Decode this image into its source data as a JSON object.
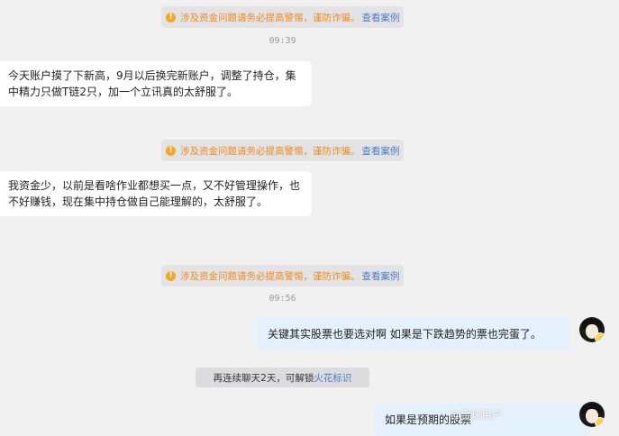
{
  "notices": [
    {
      "text": "涉及资金问题请务必提高警惕，谨防诈骗。",
      "link": "查看案例"
    },
    {
      "text": "涉及资金问题请务必提高警惕，谨防诈骗。",
      "link": "查看案例"
    },
    {
      "text": "涉及资金问题请务必提高警惕，谨防诈骗。",
      "link": "查看案例"
    }
  ],
  "times": [
    "09:39",
    "09:56"
  ],
  "messages": [
    {
      "text": "今天账户摸了下新高，9月以后换完新账户，调整了持仓，集中精力只做T链2只，加一个立讯真的太舒服了。"
    },
    {
      "text": "我资金少，以前是看啥作业都想买一点，又不好管理操作，也不好赚钱，现在集中持仓做自己能理解的，太舒服了。"
    },
    {
      "text": "关键其实股票也要选对啊 如果是下跌趋势的票也完蛋了。"
    },
    {
      "text": "如果是预期的股票"
    }
  ],
  "spark": {
    "prefix": "再连续聊天2天，可解锁",
    "link": "火花标识"
  },
  "watermark": "@雪球用户"
}
